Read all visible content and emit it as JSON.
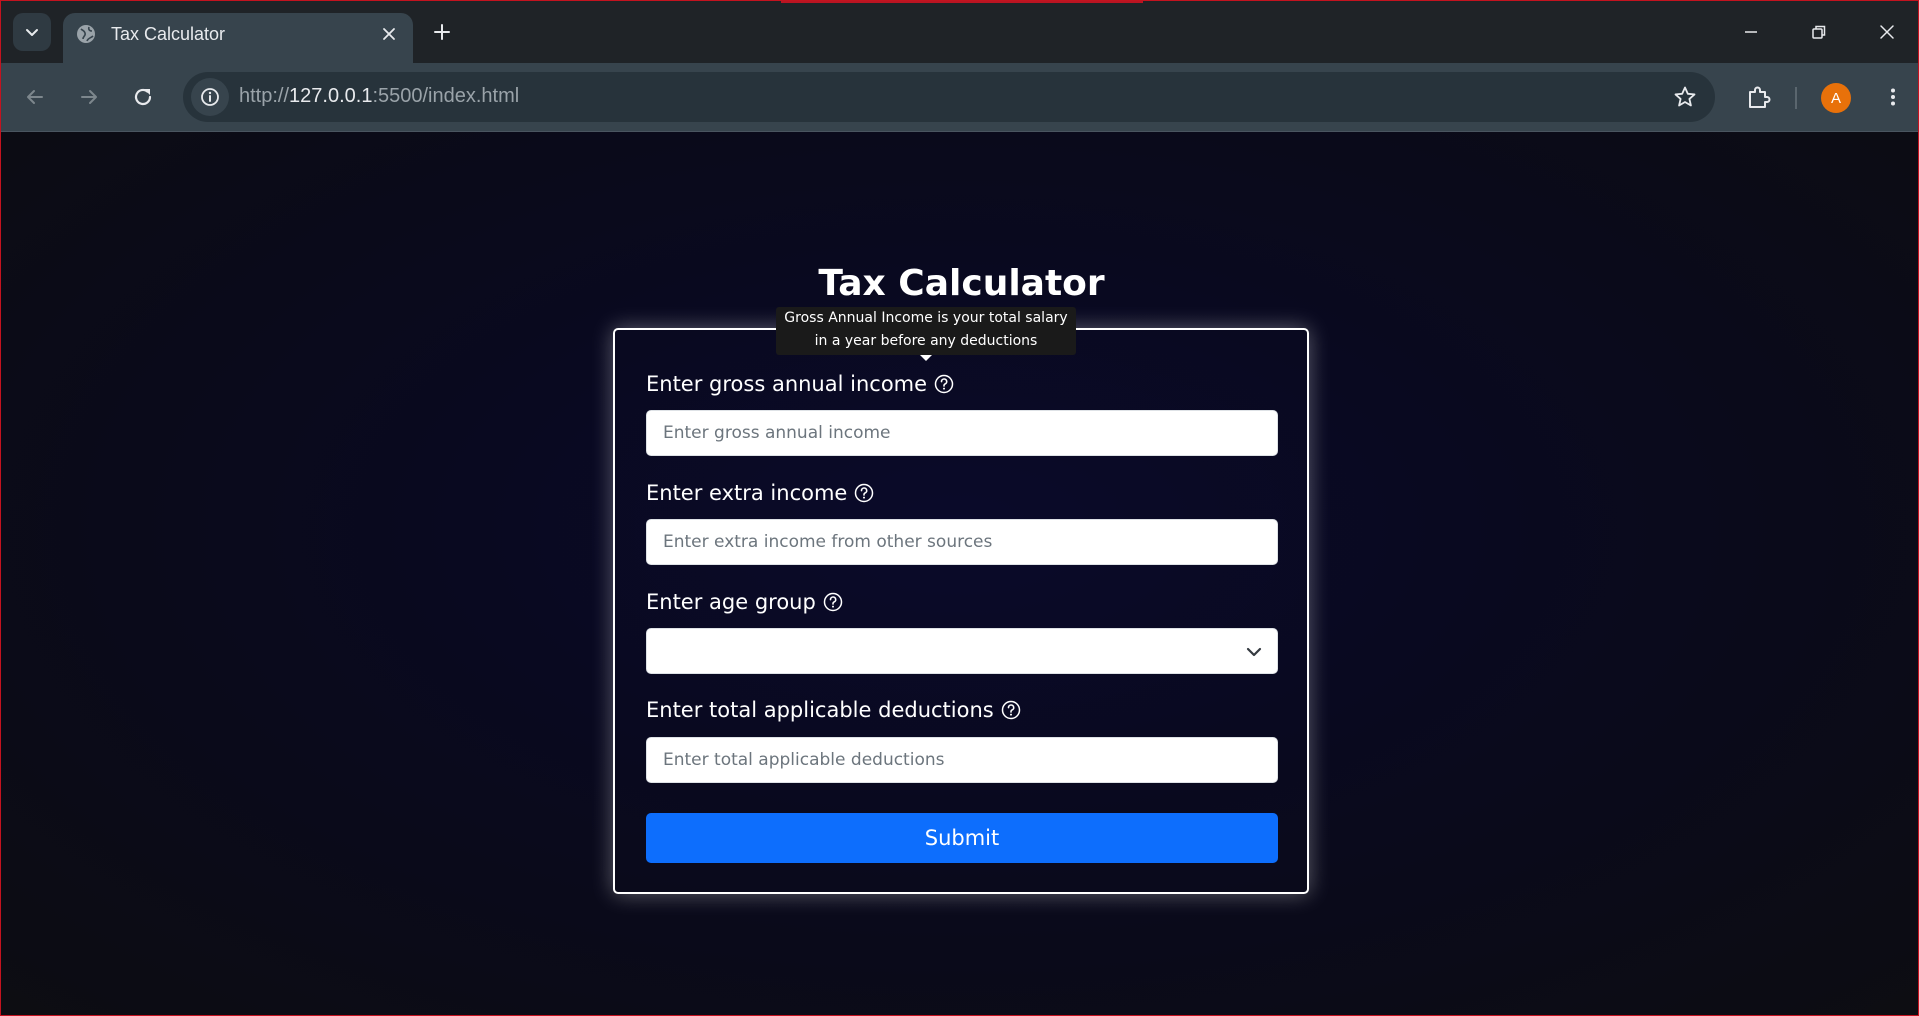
{
  "browser": {
    "tab_title": "Tax Calculator",
    "url_prefix": "http://",
    "url_host": "127.0.0.1",
    "url_suffix": ":5500/index.html",
    "profile_initial": "A",
    "profile_color": "#e8710a"
  },
  "page": {
    "title": "Tax Calculator",
    "tooltip": "Gross Annual Income is your total salary in a year before any deductions",
    "fields": {
      "gross_income": {
        "label": "Enter gross annual income",
        "placeholder": "Enter gross annual income",
        "value": ""
      },
      "extra_income": {
        "label": "Enter extra income",
        "placeholder": "Enter extra income from other sources",
        "value": ""
      },
      "age_group": {
        "label": "Enter age group",
        "selected": ""
      },
      "deductions": {
        "label": "Enter total applicable deductions",
        "placeholder": "Enter total applicable deductions",
        "value": ""
      }
    },
    "submit_label": "Submit",
    "accent_color": "#0d6efd",
    "icons": {
      "help": "question-circle-icon",
      "select": "chevron-down-icon"
    }
  }
}
